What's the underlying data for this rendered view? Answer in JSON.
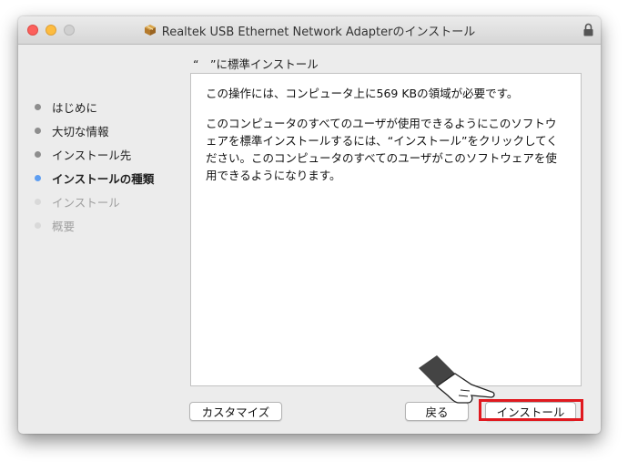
{
  "window": {
    "title": "Realtek USB Ethernet Network Adapterのインストール",
    "subtitle": "“　”に標準インストール"
  },
  "sidebar": {
    "items": [
      {
        "label": "はじめに",
        "state": "done"
      },
      {
        "label": "大切な情報",
        "state": "done"
      },
      {
        "label": "インストール先",
        "state": "done"
      },
      {
        "label": "インストールの種類",
        "state": "current"
      },
      {
        "label": "インストール",
        "state": "future"
      },
      {
        "label": "概要",
        "state": "future"
      }
    ]
  },
  "content": {
    "paragraph1": "この操作には、コンピュータ上に569 KBの領域が必要です。",
    "paragraph2": "このコンピュータのすべてのユーザが使用できるようにこのソフトウェアを標準インストールするには、“インストール”をクリックしてください。このコンピュータのすべてのユーザがこのソフトウェアを使用できるようになります。"
  },
  "buttons": {
    "customize": "カスタマイズ",
    "back": "戻る",
    "install": "インストール"
  },
  "colors": {
    "highlight": "#e0191f",
    "current_step_dot": "#5e9ef1",
    "close": "#fc605c",
    "minimize": "#fdbc40"
  },
  "icons": {
    "title": "package-icon",
    "lock": "lock-icon",
    "pointer": "pointing-hand-icon"
  }
}
